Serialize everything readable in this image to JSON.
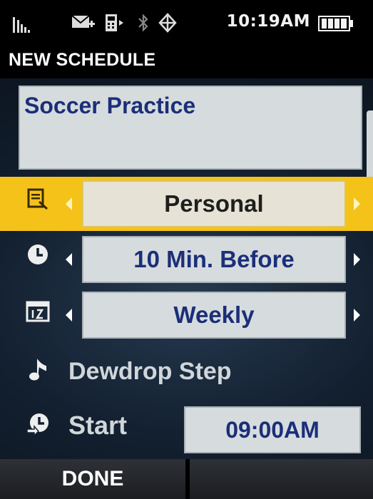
{
  "status_bar": {
    "time": "10:19AM",
    "icons": [
      "signal-icon",
      "message-icon",
      "phone-icon",
      "bluetooth-icon",
      "gps-icon",
      "battery-icon"
    ]
  },
  "title": "NEW SCHEDULE",
  "event_name": "Soccer Practice",
  "fields": {
    "category": {
      "icon": "category-icon",
      "value": "Personal",
      "selected": true
    },
    "alert": {
      "icon": "clock-icon",
      "value": "10 Min. Before"
    },
    "repeat": {
      "icon": "repeat-icon",
      "value": "Weekly"
    },
    "ringtone": {
      "icon": "music-note-icon",
      "value": "Dewdrop Step"
    },
    "start": {
      "icon": "start-time-icon",
      "label": "Start",
      "value": "09:00AM"
    }
  },
  "softkeys": {
    "left": "DONE",
    "right": ""
  },
  "colors": {
    "selection": "#f5c21a",
    "field_text": "#1b2f78",
    "field_bg": "#d6dbde"
  }
}
